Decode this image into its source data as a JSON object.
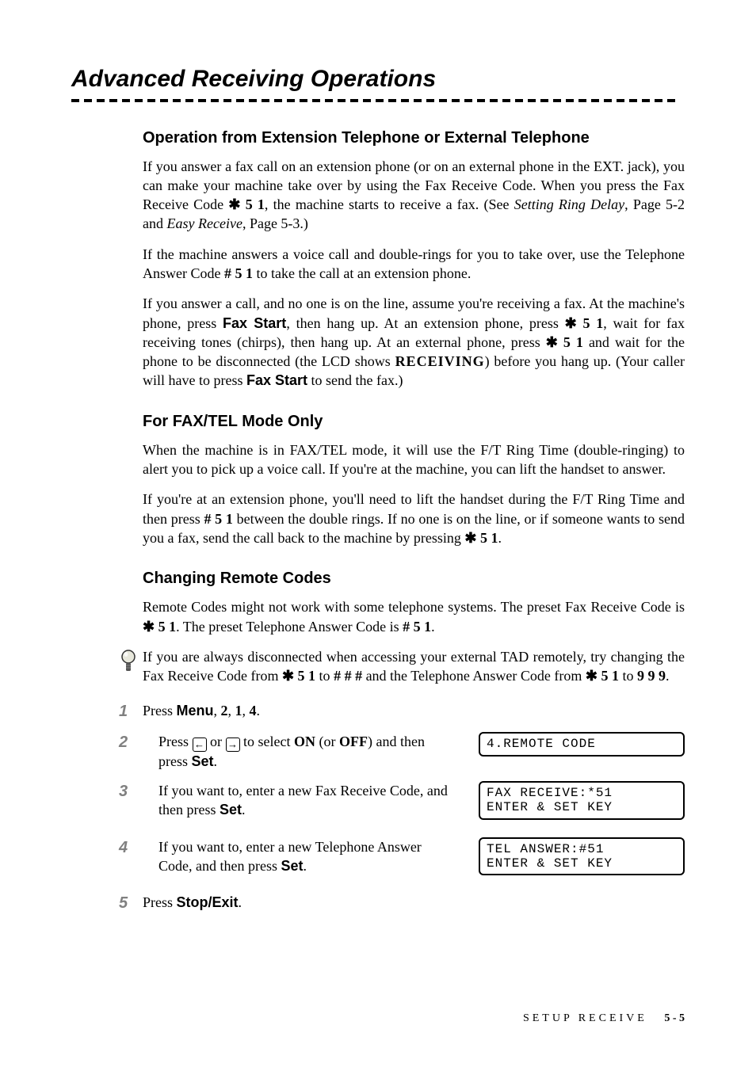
{
  "title": "Advanced Receiving Operations",
  "sections": {
    "s1": {
      "heading": "Operation from Extension Telephone or External Telephone",
      "p1a": "If you answer a fax call on an extension phone (or on an external phone in the EXT.  jack), you can make your machine take over by using the Fax Receive Code. When you press the Fax Receive Code ",
      "p1code": " 5 1",
      "p1b": ", the machine starts to receive a fax. (See ",
      "p1ref1": "Setting Ring Delay",
      "p1c": ", Page 5-2 and ",
      "p1ref2": "Easy Receive",
      "p1d": ", Page 5-3.)",
      "p2a": "If the machine answers a voice call and double-rings for you to take over, use the Telephone Answer Code ",
      "p2code": "# 5 1",
      "p2b": " to take the call at an extension phone.",
      "p3a": "If you answer a call, and no one is on the line, assume you're receiving a fax. At the machine's phone, press ",
      "p3faxstart1": "Fax Start",
      "p3b": ", then hang up.  At an extension phone, press ",
      "p3code1": " 5 1",
      "p3c": ", wait for fax receiving tones (chirps), then hang up.  At an external phone, press ",
      "p3code2": " 5 1",
      "p3d": " and wait for the phone to be disconnected (the LCD shows ",
      "p3receiving": "RECEIVING",
      "p3e": ") before you hang up.  (Your caller will have to press ",
      "p3faxstart2": "Fax Start",
      "p3f": " to send the fax.)"
    },
    "s2": {
      "heading": "For FAX/TEL Mode Only",
      "p1": "When the machine is in FAX/TEL mode, it will use the F/T Ring Time (double-ringing) to alert you to pick up a voice call. If you're at the machine, you can lift the handset to answer.",
      "p2a": "If you're at an extension phone, you'll need to lift the handset during the F/T Ring Time and then press ",
      "p2code1": "# 5 1",
      "p2b": " between the double rings. If no one is on the line, or if someone wants to send you a fax, send the call back to the machine by pressing ",
      "p2code2": " 5 1",
      "p2c": "."
    },
    "s3": {
      "heading": "Changing Remote Codes",
      "p1a": "Remote Codes might not work with some telephone systems. The preset Fax Receive Code is ",
      "p1code1": " 5 1",
      "p1b": ". The preset Telephone Answer Code is ",
      "p1code2": "# 5 1",
      "p1c": ".",
      "note_a": "If you are always disconnected when accessing your external TAD remotely, try changing the Fax Receive Code from ",
      "note_code1": " 5 1",
      "note_b": " to ",
      "note_code2": "# # #",
      "note_c": " and the Telephone Answer Code from ",
      "note_code3": " 5 1",
      "note_d": " to ",
      "note_code4": "9 9 9",
      "note_e": "."
    }
  },
  "steps": [
    {
      "num": "1",
      "pre": "Press ",
      "bold": "Menu",
      "mid": ", ",
      "b2": "2",
      "m2": ", ",
      "b3": "1",
      "m3": ", ",
      "b4": "4",
      "post": "."
    },
    {
      "num": "2",
      "pre": "Press ",
      "post_arr": " or ",
      "after": " to select ",
      "on": "ON",
      "or": " (or ",
      "off": "OFF",
      "tail1": ") and then press ",
      "set": "Set",
      "tail2": "."
    },
    {
      "num": "3",
      "text_a": "If you want to, enter a new Fax Receive Code, and then press ",
      "set": "Set",
      "text_b": "."
    },
    {
      "num": "4",
      "text_a": "If you want to, enter a new Telephone Answer Code, and then press ",
      "set": "Set",
      "text_b": "."
    },
    {
      "num": "5",
      "pre": "Press ",
      "stop": "Stop/Exit",
      "post": "."
    }
  ],
  "lcd": {
    "l1": "4.REMOTE CODE",
    "l2": "FAX RECEIVE:*51\nENTER & SET KEY",
    "l3": "TEL ANSWER:#51\nENTER & SET KEY"
  },
  "footer": {
    "label": "SETUP RECEIVE",
    "page": "5 - 5"
  },
  "star": "✱"
}
